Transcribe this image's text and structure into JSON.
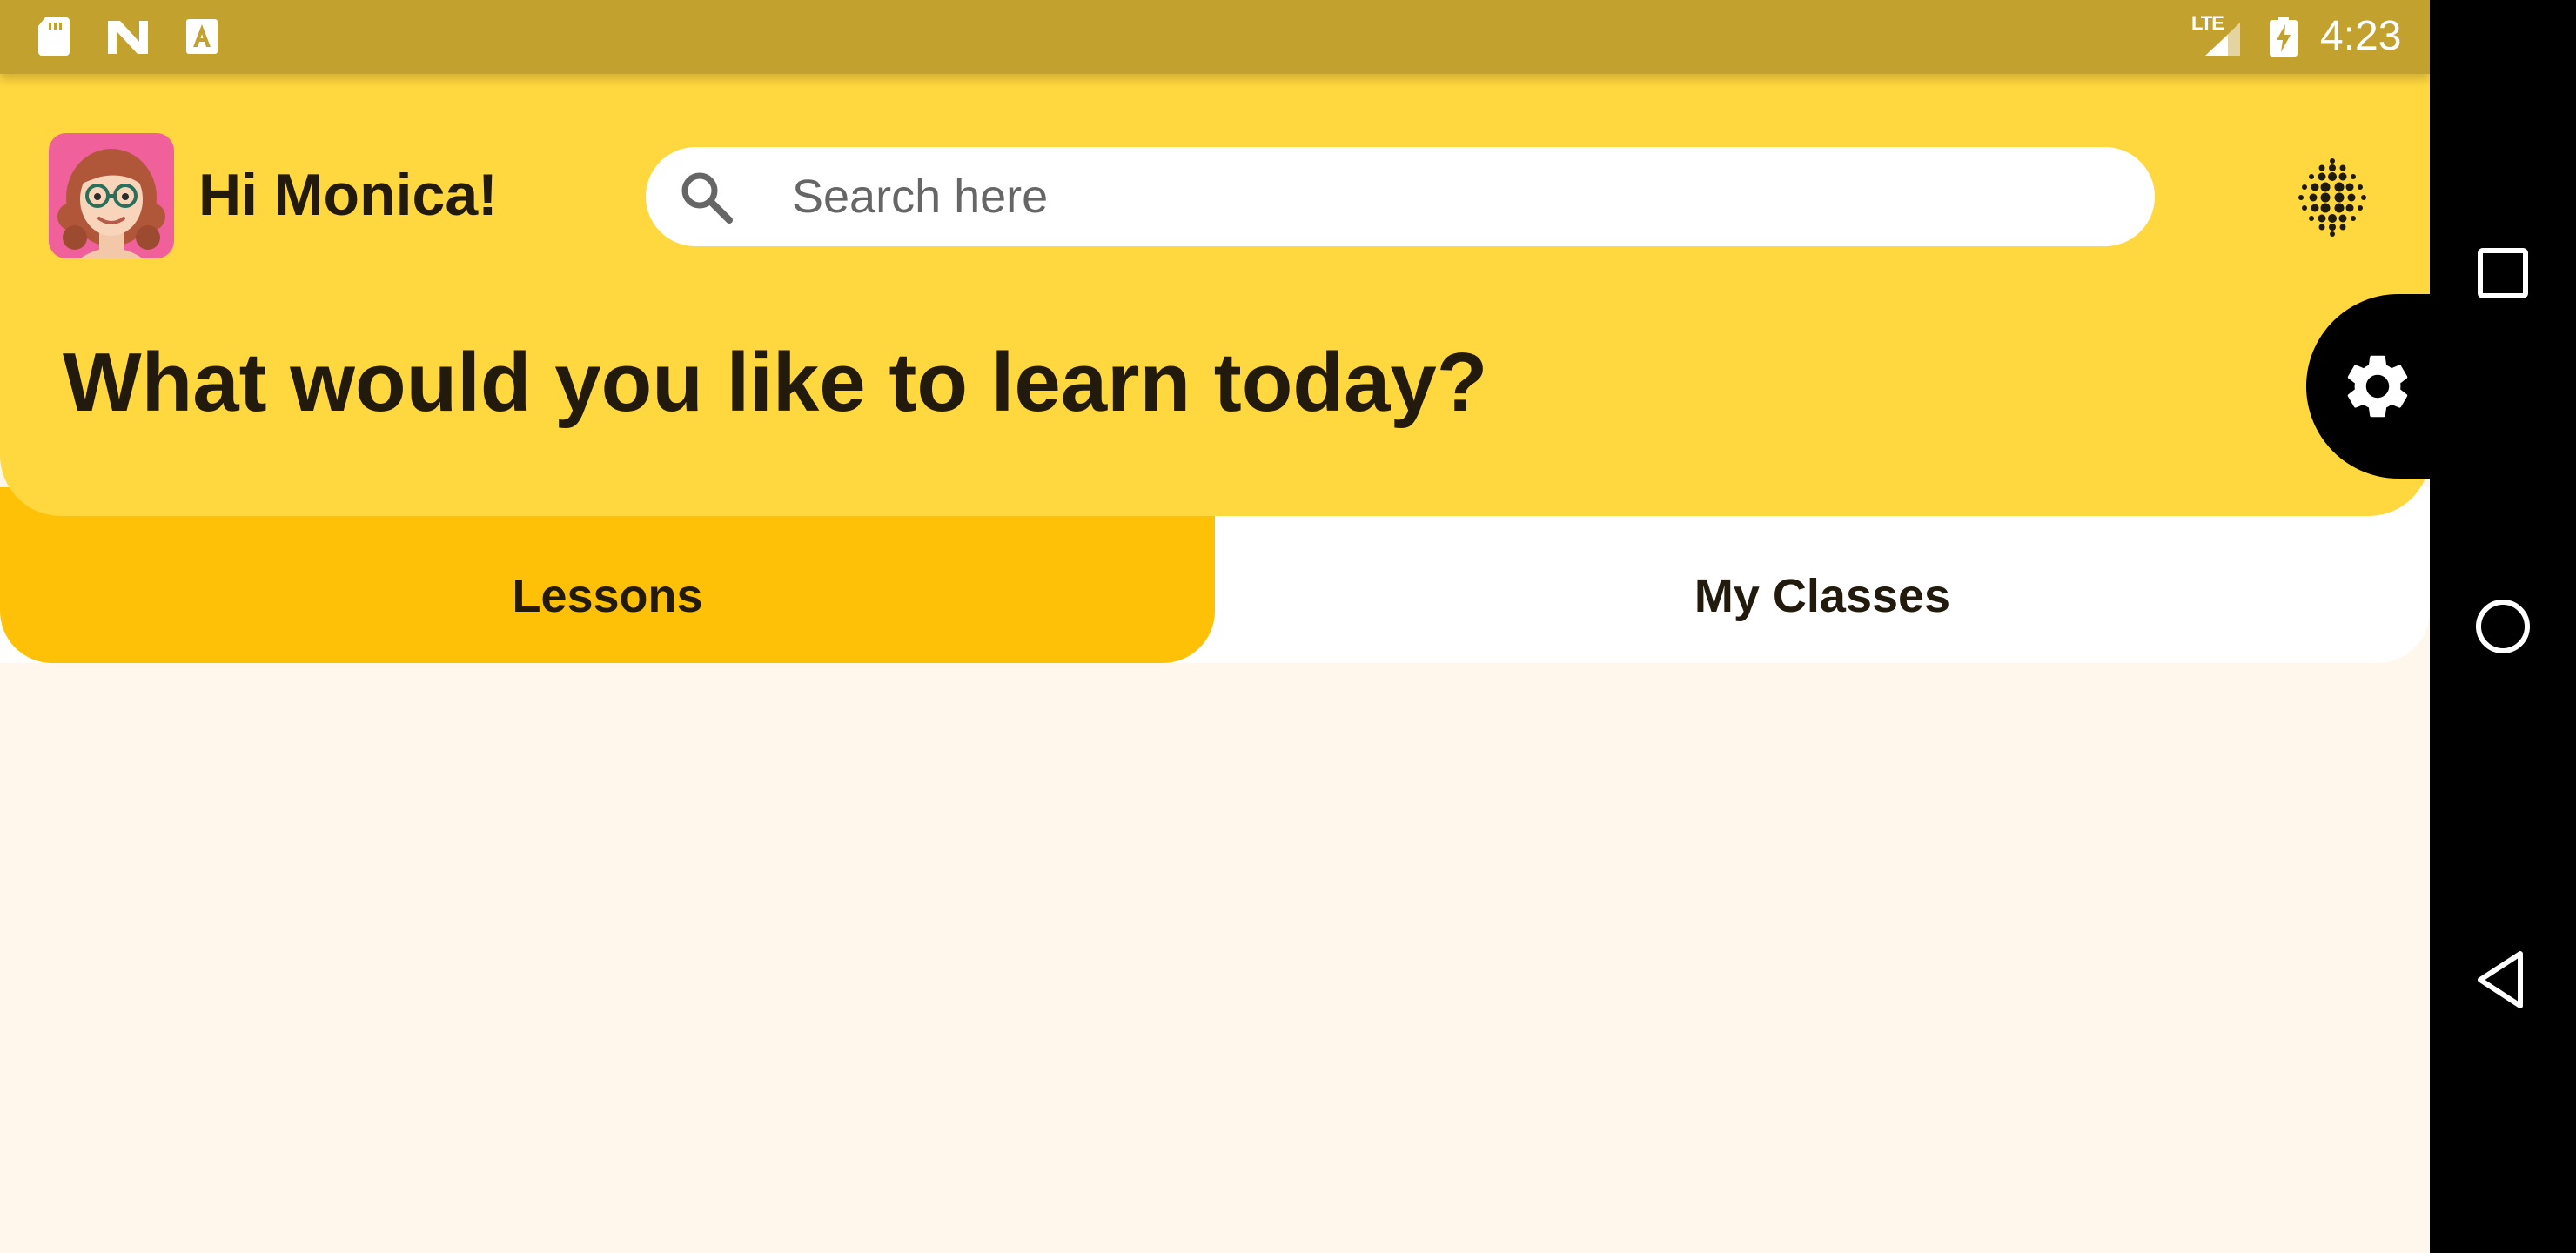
{
  "status_bar": {
    "icons": [
      "sd-card-icon",
      "n-logo-icon",
      "a-text-icon"
    ],
    "network": "LTE",
    "time": "4:23"
  },
  "header": {
    "greeting": "Hi Monica!",
    "avatar_icon": "female-avatar-icon",
    "search": {
      "placeholder": "Search here",
      "value": ""
    },
    "apps_icon": "dots-grid-icon",
    "headline": "What would you like to learn today?"
  },
  "settings_button": {
    "icon": "gear-icon"
  },
  "tabs": [
    {
      "label": "Lessons",
      "selected": true
    },
    {
      "label": "My Classes",
      "selected": false
    }
  ],
  "nav_bar": {
    "buttons": [
      "recents-icon",
      "home-icon",
      "back-icon"
    ]
  },
  "colors": {
    "status_bar": "#C2A12F",
    "header": "#FFD73F",
    "active_tab": "#FFC107",
    "background": "#FFF7EC",
    "text": "#221A0C",
    "avatar_bg": "#F0609A"
  }
}
